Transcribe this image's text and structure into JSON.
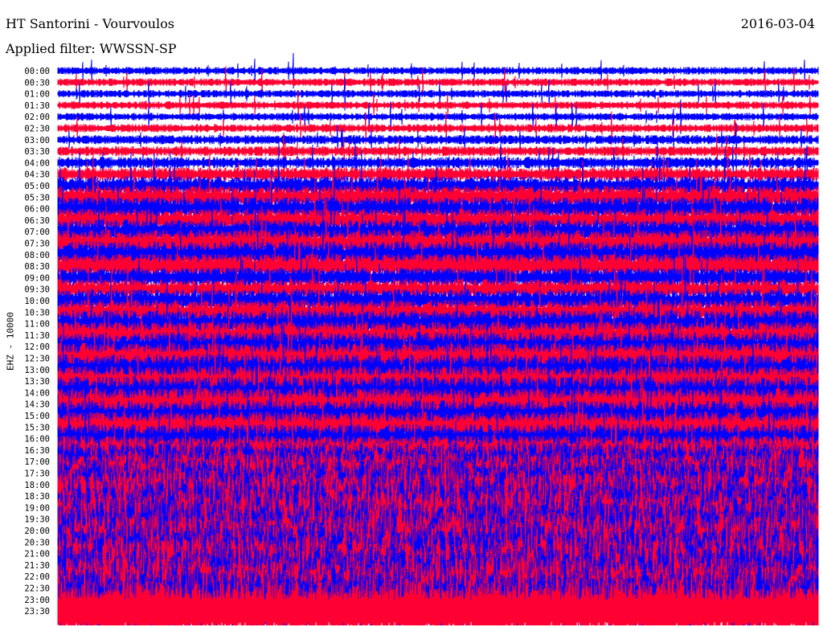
{
  "header": {
    "title": "HT Santorini - Vourvoulos",
    "date": "2016-03-04",
    "filter": "Applied filter: WWSSN-SP"
  },
  "chart_data": {
    "type": "line",
    "title": "HT Santorini - Vourvoulos",
    "ylabel": "EHZ - 10000",
    "xlabel": "",
    "colors": [
      "#0000ff",
      "#ff0033"
    ],
    "row_labels": [
      "00:00",
      "00:30",
      "01:00",
      "01:30",
      "02:00",
      "02:30",
      "03:00",
      "03:30",
      "04:00",
      "04:30",
      "05:00",
      "05:30",
      "06:00",
      "06:30",
      "07:00",
      "07:30",
      "08:00",
      "08:30",
      "09:00",
      "09:30",
      "10:00",
      "10:30",
      "11:00",
      "11:30",
      "12:00",
      "12:30",
      "13:00",
      "13:30",
      "14:00",
      "14:30",
      "15:00",
      "15:30",
      "16:00",
      "16:30",
      "17:00",
      "17:30",
      "18:00",
      "18:30",
      "19:00",
      "19:30",
      "20:00",
      "20:30",
      "21:00",
      "21:30",
      "22:00",
      "22:30",
      "23:00",
      "23:30"
    ],
    "relative_amplitude": [
      1,
      1,
      1,
      1,
      1,
      1.1,
      1.2,
      1.3,
      1.5,
      1.8,
      2.5,
      3,
      3,
      3,
      3.2,
      3.5,
      3.5,
      3.2,
      2.6,
      2.6,
      3,
      3.2,
      3.5,
      3.5,
      3.8,
      4,
      4,
      4,
      4.2,
      4.2,
      4,
      4,
      3.8,
      3.8,
      5,
      6,
      7,
      7.5,
      8,
      8,
      8.5,
      8.5,
      8.5,
      8.5,
      8.5,
      8.5,
      8.5,
      8.5
    ]
  }
}
